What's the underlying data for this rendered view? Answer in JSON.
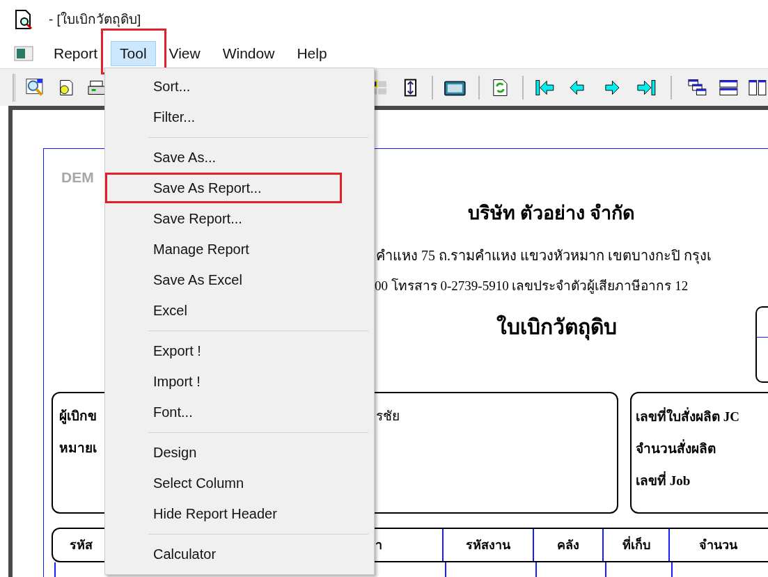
{
  "window": {
    "title": "- [ใบเบิกวัตถุดิบ]"
  },
  "menu_bar": [
    {
      "label": "Report",
      "selected": false,
      "annotated": false
    },
    {
      "label": "Tool",
      "selected": true,
      "annotated": true
    },
    {
      "label": "View",
      "selected": false,
      "annotated": false
    },
    {
      "label": "Window",
      "selected": false,
      "annotated": false
    },
    {
      "label": "Help",
      "selected": false,
      "annotated": false
    }
  ],
  "dropdown": {
    "groups": [
      [
        {
          "label": "Sort...",
          "annotated": false
        },
        {
          "label": "Filter...",
          "annotated": false
        }
      ],
      [
        {
          "label": "Save As...",
          "annotated": false
        },
        {
          "label": "Save As Report...",
          "annotated": true
        },
        {
          "label": "Save Report...",
          "annotated": false
        },
        {
          "label": "Manage Report",
          "annotated": false
        },
        {
          "label": "Save As Excel",
          "annotated": false
        },
        {
          "label": "Excel",
          "annotated": false
        }
      ],
      [
        {
          "label": "Export !",
          "annotated": false
        },
        {
          "label": "Import !",
          "annotated": false
        },
        {
          "label": "Font...",
          "annotated": false
        }
      ],
      [
        {
          "label": "Design",
          "annotated": false
        },
        {
          "label": "Select Column",
          "annotated": false
        },
        {
          "label": "Hide Report Header",
          "annotated": false
        }
      ],
      [
        {
          "label": "Calculator",
          "annotated": false
        }
      ]
    ]
  },
  "report": {
    "watermark": "DEM",
    "company_name": "บริษัท ตัวอย่าง จำกัด",
    "address": "คำแหง 75 ถ.รามคำแหง แขวงหัวหมาก เขตบางกะปิ กรุงเ",
    "contact_line": "00  โทรสาร 0-2739-5910  เลขประจำตัวผู้เสียภาษีอากร 12",
    "document_title": "ใบเบิกวัตถุดิบ",
    "requester_box": {
      "rows": [
        {
          "label": "ผู้เบิกข",
          "value": "รชัย"
        },
        {
          "label": "หมายเ"
        }
      ]
    },
    "order_box": {
      "fields": [
        "เลขที่ใบสั่งผลิต JC",
        "จำนวนสั่งผลิต",
        "เลขที่ Job"
      ]
    },
    "table": {
      "columns": [
        "รหัส",
        "า",
        "รหัสงาน",
        "คลัง",
        "ที่เก็บ",
        "จำนวน"
      ]
    }
  }
}
